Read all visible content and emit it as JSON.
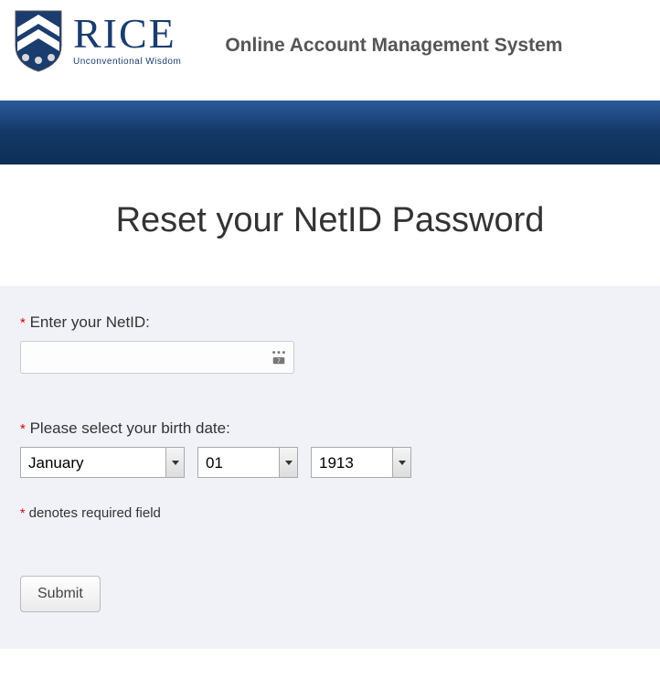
{
  "header": {
    "brand": "RICE",
    "tagline": "Unconventional Wisdom",
    "system_title": "Online Account Management System"
  },
  "page": {
    "title": "Reset your NetID Password"
  },
  "form": {
    "netid_label": "Enter your NetID:",
    "netid_value": "",
    "birthdate_label": "Please select your birth date:",
    "month_value": "January",
    "day_value": "01",
    "year_value": "1913",
    "required_note": "denotes required field",
    "submit_label": "Submit",
    "required_marker": "*"
  }
}
